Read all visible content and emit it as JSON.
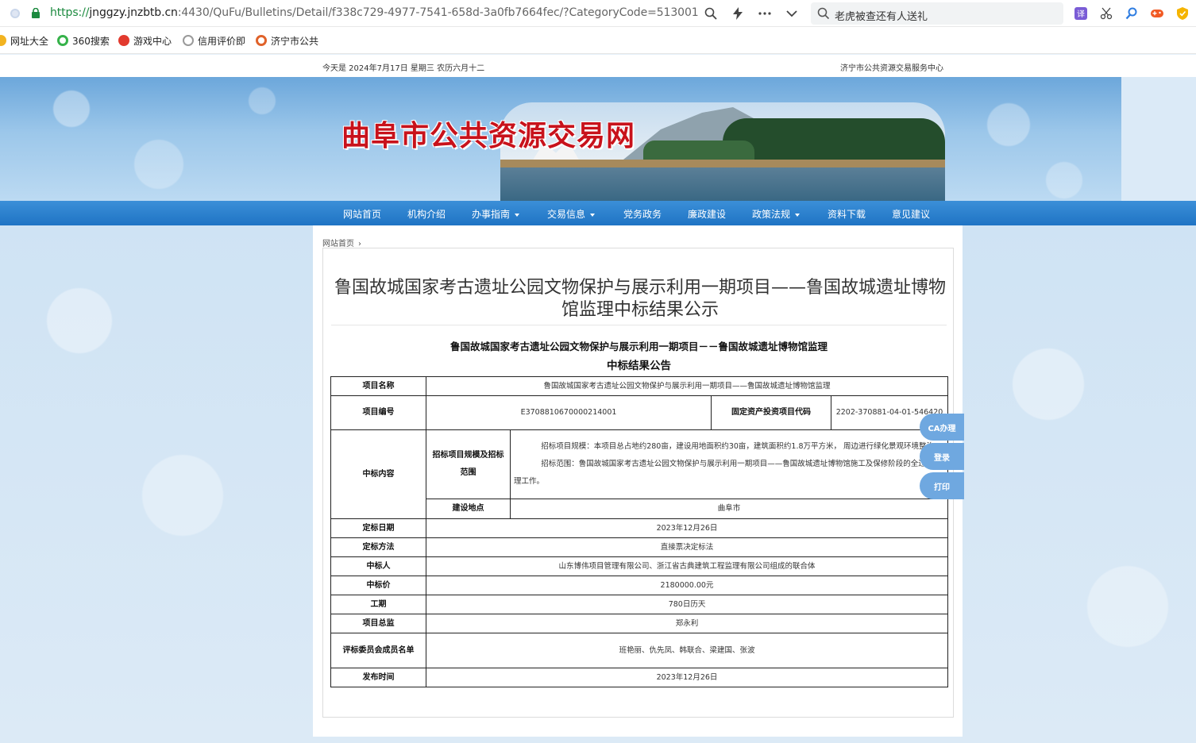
{
  "browser": {
    "url_scheme": "https://",
    "url_host": "jnggzy.jnzbtb.cn",
    "url_rest": ":4430/QuFu/Bulletins/Detail/f338c729-4977-7541-658d-3a0fb7664fec/?CategoryCode=513001",
    "search_text": "老虎被查还有人送礼",
    "bookmarks": [
      {
        "label": "网址大全",
        "color": "#f2b320"
      },
      {
        "label": "360搜索",
        "color": "#36b24a"
      },
      {
        "label": "游戏中心",
        "color": "#e23a2e"
      },
      {
        "label": "信用评价即",
        "color": "#9a9a9a"
      },
      {
        "label": "济宁市公共",
        "color": "#e0622a"
      }
    ]
  },
  "site": {
    "date_line": "今天是  2024年7月17日  星期三  农历六月十二",
    "center_name": "济宁市公共资源交易服务中心",
    "title": "曲阜市公共资源交易网",
    "nav": [
      {
        "label": "网站首页",
        "dropdown": false
      },
      {
        "label": "机构介绍",
        "dropdown": false
      },
      {
        "label": "办事指南",
        "dropdown": true
      },
      {
        "label": "交易信息",
        "dropdown": true
      },
      {
        "label": "党务政务",
        "dropdown": false
      },
      {
        "label": "廉政建设",
        "dropdown": false
      },
      {
        "label": "政策法规",
        "dropdown": true
      },
      {
        "label": "资料下载",
        "dropdown": false
      },
      {
        "label": "意见建议",
        "dropdown": false
      }
    ],
    "breadcrumb": "网站首页",
    "side_buttons": [
      "CA办理",
      "登录",
      "打印"
    ]
  },
  "article": {
    "title": "鲁国故城国家考古遗址公园文物保护与展示利用一期项目——鲁国故城遗址博物馆监理中标结果公示",
    "doc_heading": "鲁国故城国家考古遗址公园文物保护与展示利用一期项目－－鲁国故城遗址博物馆监理",
    "doc_subheading": "中标结果公告",
    "table": {
      "project_name_label": "项目名称",
      "project_name": "鲁国故城国家考古遗址公园文物保护与展示利用一期项目——鲁国故城遗址博物馆监理",
      "project_no_label": "项目编号",
      "project_no": "E3708810670000214001",
      "fixed_code_label": "固定资产投资项目代码",
      "fixed_code": "2202-370881-04-01-546420",
      "content_label": "中标内容",
      "scope_label": "招标项目规模及招标范围",
      "scope_p1": "招标项目规模：本项目总占地约280亩，建设用地面积约30亩，建筑面积约1.8万平方米，   周边进行绿化景观环境整治。",
      "scope_p2": "招标范围：鲁国故城国家考古遗址公园文物保护与展示利用一期项目——鲁国故城遗址博物馆施工及保修阶段的全过程监理工作。",
      "location_label": "建设地点",
      "location": "曲阜市",
      "award_date_label": "定标日期",
      "award_date": "2023年12月26日",
      "award_method_label": "定标方法",
      "award_method": "直接票决定标法",
      "winner_label": "中标人",
      "winner": "山东博伟项目管理有限公司、浙江省古典建筑工程监理有限公司组成的联合体",
      "price_label": "中标价",
      "price": "2180000.00元",
      "duration_label": "工期",
      "duration": "780日历天",
      "supervisor_label": "项目总监",
      "supervisor": "郑永利",
      "committee_label": "评标委员会成员名单",
      "committee": "班艳丽、仇先凤、韩联合、梁建国、张波",
      "publish_label": "发布时间",
      "publish": "2023年12月26日"
    }
  }
}
